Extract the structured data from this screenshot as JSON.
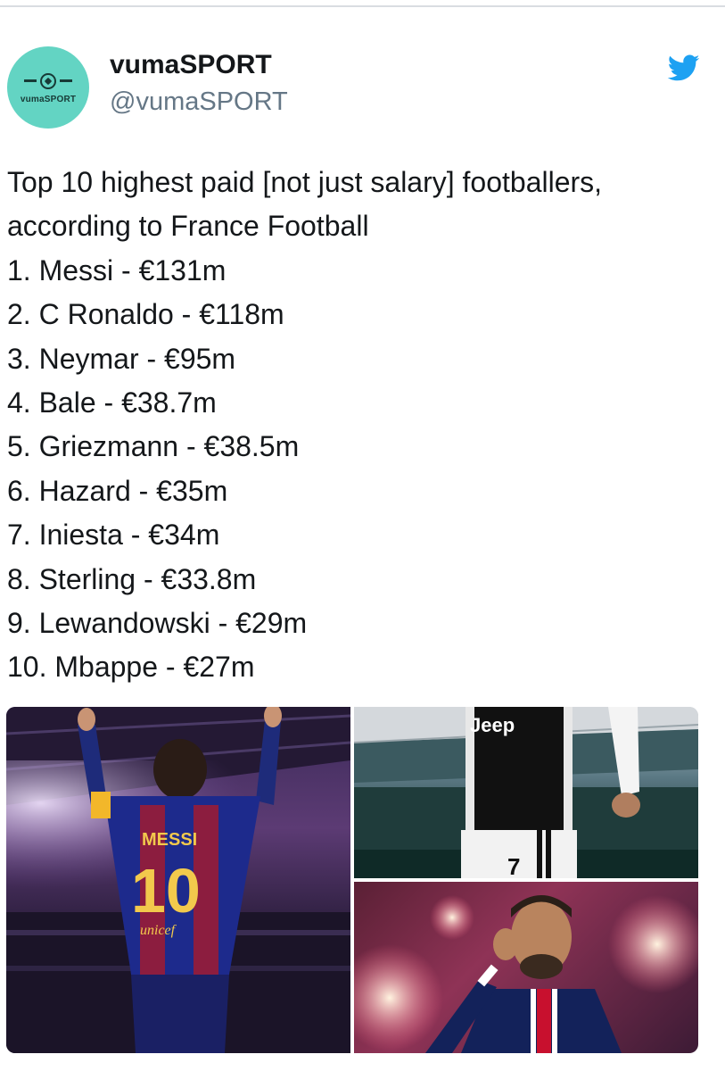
{
  "account": {
    "display_name": "vumaSPORT",
    "handle": "@vumaSPORT",
    "avatar_text": "vumaSPORT"
  },
  "icons": {
    "platform": "twitter-bird-icon",
    "avatar_mark": "soccer-ball-icon"
  },
  "colors": {
    "avatar_bg": "#63d4c3",
    "twitter_blue": "#1da1f2",
    "handle_gray": "#657786",
    "text": "#14171a"
  },
  "tweet": {
    "lines": [
      "Top 10 highest paid [not just salary] footballers,",
      "according to France Football",
      "1. Messi - €131m",
      "2. C Ronaldo - €118m",
      "3. Neymar - €95m",
      "4. Bale - €38.7m",
      "5. Griezmann - €38.5m",
      "6. Hazard - €35m",
      "7. Iniesta - €34m",
      "8. Sterling - €33.8m",
      "9. Lewandowski - €29m",
      "10. Mbappe - €27m"
    ]
  },
  "media": {
    "left": {
      "shirt_name": "MESSI",
      "shirt_number": "10",
      "sponsor": "unicef"
    },
    "top_right": {
      "sponsor": "Jeep",
      "shirt_number": "7"
    },
    "bottom_right": {}
  }
}
